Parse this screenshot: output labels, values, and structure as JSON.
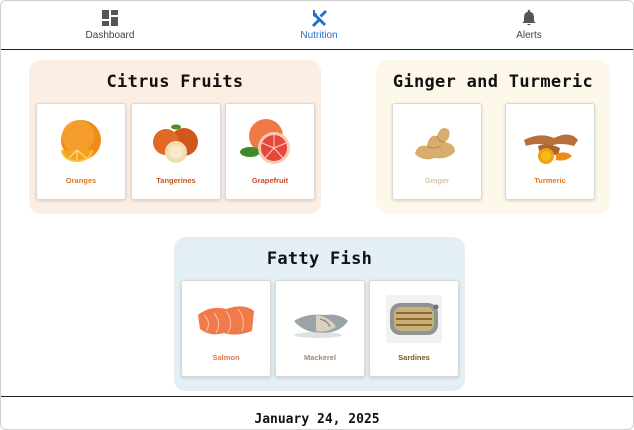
{
  "nav": {
    "items": [
      {
        "label": "Dashboard",
        "icon": "dashboard-icon",
        "active": false
      },
      {
        "label": "Nutrition",
        "icon": "fork-knife-icon",
        "active": true
      },
      {
        "label": "Alerts",
        "icon": "bell-icon",
        "active": false
      }
    ],
    "active_color": "#1f6fc5"
  },
  "sections": {
    "citrus": {
      "title": "Citrus Fruits",
      "background": "#fdeee4",
      "items": [
        {
          "label": "Oranges",
          "label_color": "#e07a1f"
        },
        {
          "label": "Tangerines",
          "label_color": "#c4561c"
        },
        {
          "label": "Grapefruit",
          "label_color": "#c94a2b"
        }
      ]
    },
    "ginger": {
      "title": "Ginger and Turmeric",
      "background": "#fdf8ea",
      "items": [
        {
          "label": "Ginger",
          "label_color": "#d8c3a3"
        },
        {
          "label": "Turmeric",
          "label_color": "#e07a1f"
        }
      ]
    },
    "fish": {
      "title": "Fatty Fish",
      "background": "#e3eff4",
      "items": [
        {
          "label": "Salmon",
          "label_color": "#e07a4a"
        },
        {
          "label": "Mackerel",
          "label_color": "#a08a6e"
        },
        {
          "label": "Sardines",
          "label_color": "#7a5a1e"
        }
      ]
    }
  },
  "footer": {
    "date": "January 24, 2025"
  }
}
